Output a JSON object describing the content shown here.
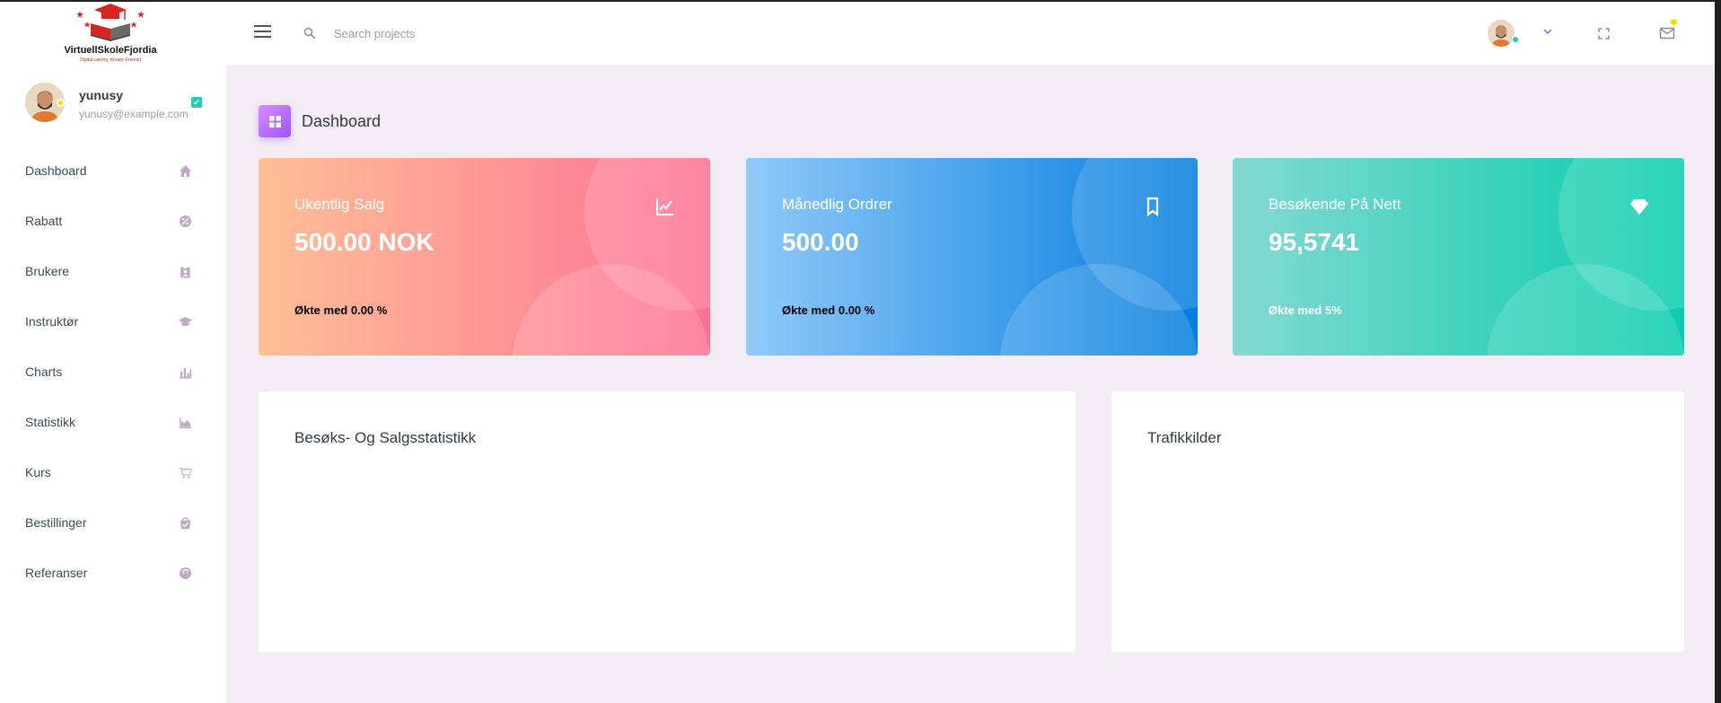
{
  "brand": {
    "name": "VirtuellSkoleFjordia",
    "tagline": "Digital Læring, Kreativ Fremtid"
  },
  "user": {
    "name": "yunusy",
    "email": "yunusy@example.com"
  },
  "sidebar": {
    "items": [
      {
        "label": "Dashboard",
        "icon": "home-icon"
      },
      {
        "label": "Rabatt",
        "icon": "discount-icon"
      },
      {
        "label": "Brukere",
        "icon": "clipboard-user-icon"
      },
      {
        "label": "Instruktør",
        "icon": "graduation-cap-icon"
      },
      {
        "label": "Charts",
        "icon": "bar-chart-icon"
      },
      {
        "label": "Statistikk",
        "icon": "area-chart-icon"
      },
      {
        "label": "Kurs",
        "icon": "cart-icon"
      },
      {
        "label": "Bestillinger",
        "icon": "shopping-bag-icon"
      },
      {
        "label": "Referanser",
        "icon": "face-icon"
      }
    ]
  },
  "header": {
    "search_placeholder": "Search projects"
  },
  "page": {
    "title": "Dashboard"
  },
  "cards": [
    {
      "title": "Ukentlig Salg",
      "value": "500.00 NOK",
      "footer": "Økte med 0.00 %",
      "icon": "line-chart-icon"
    },
    {
      "title": "Månedlig Ordrer",
      "value": "500.00",
      "footer": "Økte med 0.00 %",
      "icon": "bookmark-icon"
    },
    {
      "title": "Besøkende På Nett",
      "value": "95,5741",
      "footer": "Økte med 5%",
      "icon": "diamond-icon"
    }
  ],
  "panels": [
    {
      "title": "Besøks- Og Salgsstatistikk"
    },
    {
      "title": "Trafikkilder"
    }
  ],
  "colors": {
    "accent": "#9a55ff",
    "sidebar_icon": "#bba8bf",
    "online": "#1bcfb4",
    "notify": "#ffd500"
  }
}
